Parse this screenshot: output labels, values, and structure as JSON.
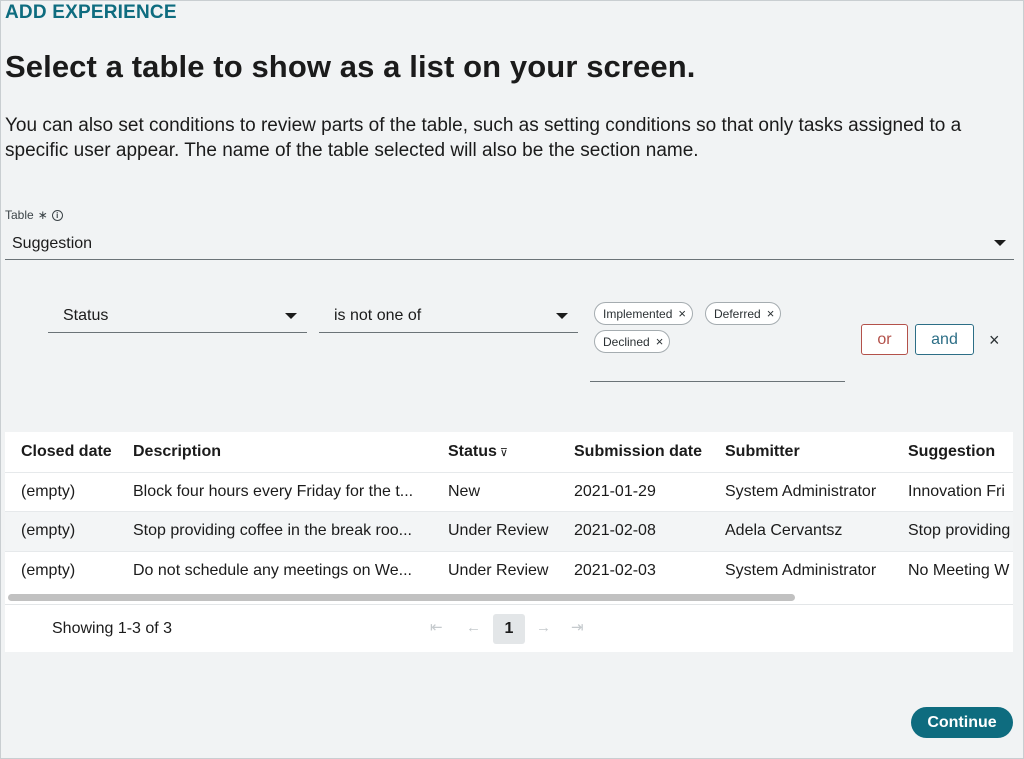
{
  "header": {
    "eyebrow": "ADD EXPERIENCE",
    "title": "Select a table to show as a list on your screen.",
    "description": "You can also set conditions to review parts of the table, such as setting conditions so that only tasks assigned to a specific user appear. The name of the table selected will also be the section name."
  },
  "table_field": {
    "label": "Table",
    "required_mark": "∗",
    "value": "Suggestion"
  },
  "condition": {
    "field": "Status",
    "operator": "is not one of",
    "values": [
      "Implemented",
      "Deferred",
      "Declined"
    ],
    "or_label": "or",
    "and_label": "and",
    "remove_icon": "×"
  },
  "grid": {
    "columns": [
      "Closed date",
      "Description",
      "Status",
      "Submission date",
      "Submitter",
      "Suggestion"
    ],
    "filter_icon": "⊽",
    "rows": [
      [
        "(empty)",
        "Block four hours every Friday for the t...",
        "New",
        "2021-01-29",
        "System Administrator",
        "Innovation Fri"
      ],
      [
        "(empty)",
        "Stop providing coffee in the break roo...",
        "Under Review",
        "2021-02-08",
        "Adela Cervantsz",
        "Stop providing"
      ],
      [
        "(empty)",
        "Do not schedule any meetings on We...",
        "Under Review",
        "2021-02-03",
        "System Administrator",
        "No Meeting W"
      ]
    ],
    "showing": "Showing 1-3 of 3",
    "page": "1"
  },
  "footer": {
    "continue_label": "Continue"
  },
  "colors": {
    "accent": "#0e6c7f",
    "or_button": "#b3514a",
    "and_button": "#2c6e86"
  }
}
